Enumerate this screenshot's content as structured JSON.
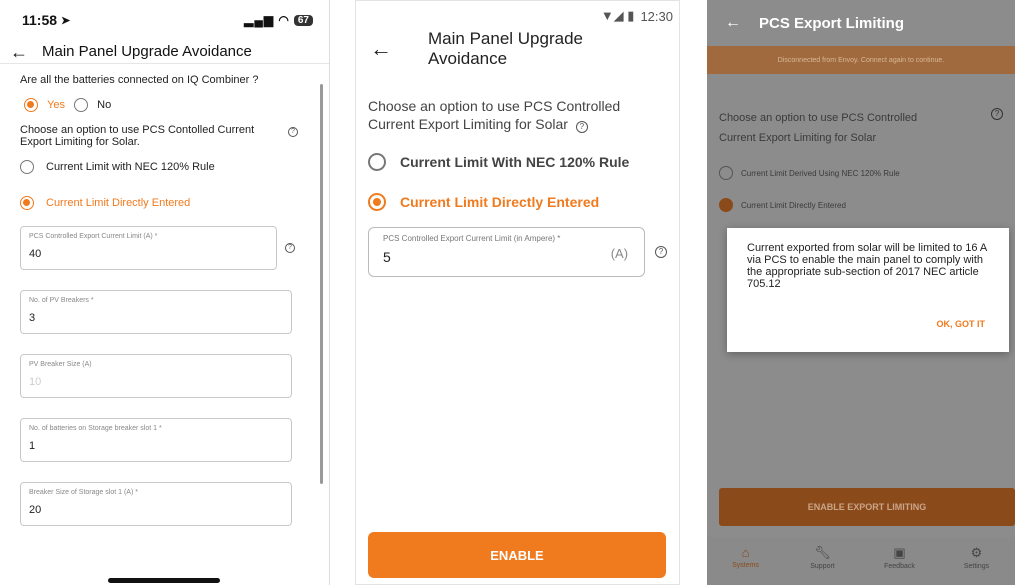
{
  "screen1": {
    "status_time": "11:58",
    "status_icons": "▂▄▆ ◠",
    "battery": "67",
    "title": "Main Panel Upgrade Avoidance",
    "question": "Are all the batteries connected on IQ Combiner ?",
    "yes_label": "Yes",
    "no_label": "No",
    "choose_text": "Choose an option to use PCS Contolled Current Export Limiting for Solar.",
    "option1_label": "Current Limit with NEC 120% Rule",
    "option2_label": "Current Limit Directly Entered",
    "fields": [
      {
        "label": "PCS Controlled Export Current Limit (A) *",
        "value": "40"
      },
      {
        "label": "No. of PV Breakers *",
        "value": "3"
      },
      {
        "label": "PV Breaker Size (A)",
        "value": "10"
      },
      {
        "label": "No. of batteries on Storage breaker slot 1 *",
        "value": "1"
      },
      {
        "label": "Breaker Size of Storage slot 1 (A) *",
        "value": "20"
      }
    ]
  },
  "screen2": {
    "status_time": "12:30",
    "title": "Main Panel Upgrade Avoidance",
    "choose_text": "Choose an option to use PCS Controlled Current Export Limiting for Solar",
    "option1_label": "Current Limit With NEC 120% Rule",
    "option2_label": "Current Limit Directly Entered",
    "field_label": "PCS Controlled Export Current Limit (in Ampere) *",
    "field_value": "5",
    "field_unit": "(A)",
    "enable_label": "ENABLE"
  },
  "screen3": {
    "title": "PCS Export Limiting",
    "banner": "Disconnected from Envoy. Connect again to continue.",
    "choose_text": "Choose an option to use PCS Controlled Current Export Limiting for Solar",
    "option1_label": "Current Limit Derived Using NEC 120% Rule",
    "option2_label": "Current Limit Directly Entered",
    "dialog_text": "Current exported from solar will be limited to 16 A via PCS to enable the main panel to comply with the appropriate sub-section of 2017 NEC article 705.12",
    "dialog_ok": "OK, GOT IT",
    "button_label": "ENABLE EXPORT LIMITING",
    "nav": [
      "Systems",
      "Support",
      "Feedback",
      "Settings"
    ]
  },
  "colors": {
    "accent": "#f07a1e",
    "dim_accent": "#8b4a1a"
  }
}
